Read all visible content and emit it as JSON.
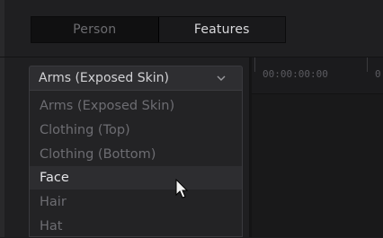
{
  "tabs": [
    {
      "label": "Person",
      "active": false
    },
    {
      "label": "Features",
      "active": true
    }
  ],
  "timeline": {
    "timecode": "00:00:00:00",
    "timecode_2": "0"
  },
  "dropdown": {
    "selected": "Arms (Exposed Skin)",
    "options": [
      "Arms (Exposed Skin)",
      "Clothing (Top)",
      "Clothing (Bottom)",
      "Face",
      "Hair",
      "Hat"
    ],
    "hovered_option": "Face"
  },
  "icons": {
    "dropdown_chevron": "chevron-down-icon",
    "cursor": "mouse-pointer-icon"
  }
}
